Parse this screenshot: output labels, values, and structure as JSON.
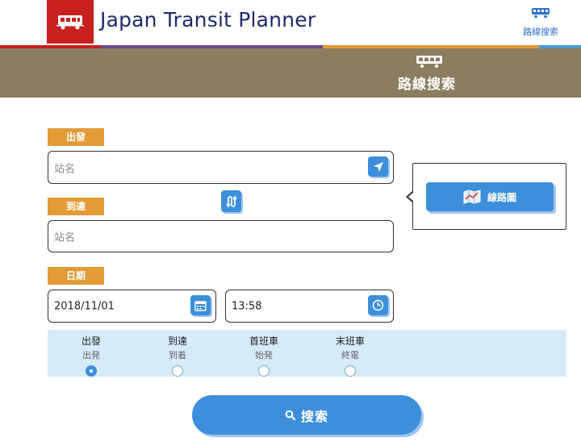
{
  "header": {
    "app_title": "Japan Transit Planner",
    "nav_search_label": "路線搜索"
  },
  "banner": {
    "title": "路線搜索"
  },
  "form": {
    "departure_label": "出發",
    "departure_placeholder": "站名",
    "arrival_label": "到達",
    "arrival_placeholder": "站名",
    "date_label": "日期",
    "date_value": "2018/11/01",
    "time_value": "13:58"
  },
  "map_button_label": "線路圖",
  "time_options": [
    {
      "label": "出發",
      "sub": "出発",
      "selected": true
    },
    {
      "label": "到達",
      "sub": "到着",
      "selected": false
    },
    {
      "label": "首班車",
      "sub": "始発",
      "selected": false
    },
    {
      "label": "末班車",
      "sub": "終電",
      "selected": false
    }
  ],
  "search_button_label": "搜索",
  "colors": {
    "brand_red": "#c8201e",
    "title_navy": "#1f2a6b",
    "banner_brown": "#8c7d61",
    "accent_orange": "#e39b37",
    "button_blue": "#3d8fdc",
    "panel_blue": "#d6ebf9"
  },
  "icons": {
    "logo": "train-icon",
    "nav": "train-icon",
    "locate": "location-arrow-icon",
    "swap": "swap-icon",
    "map": "map-icon",
    "calendar": "calendar-icon",
    "clock": "clock-icon",
    "search": "search-icon"
  }
}
